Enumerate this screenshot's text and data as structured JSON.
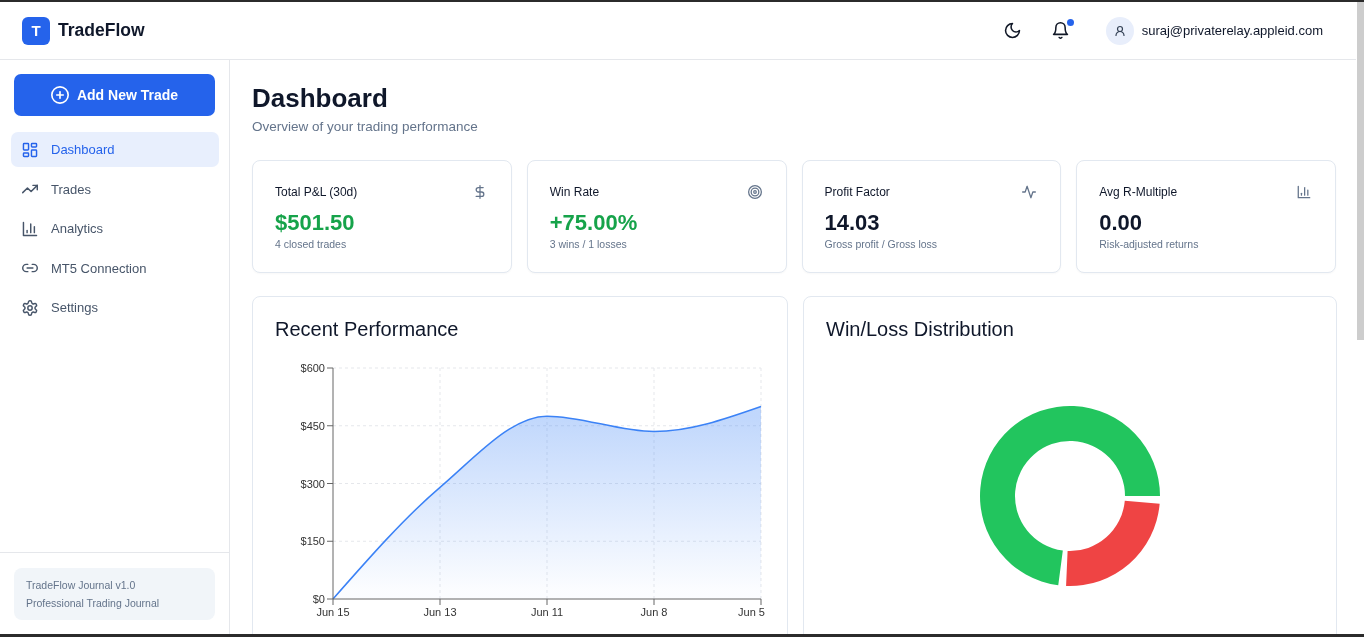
{
  "header": {
    "logo": {
      "mark": "T",
      "name": "TradeFlow"
    },
    "notifications": {
      "unread": true
    },
    "user": {
      "email": "suraj@privaterelay.appleid.com"
    }
  },
  "sidebar": {
    "action": "Add New Trade",
    "items": [
      {
        "label": "Dashboard",
        "selected": true
      },
      {
        "label": "Trades",
        "selected": false
      },
      {
        "label": "Analytics",
        "selected": false
      },
      {
        "label": "MT5 Connection",
        "selected": false
      },
      {
        "label": "Settings",
        "selected": false
      }
    ],
    "footer": [
      "TradeFlow Journal v1.0",
      "Professional Trading Journal"
    ]
  },
  "page": {
    "title": "Dashboard",
    "subtitle": "Overview of your trading performance"
  },
  "stats": [
    {
      "label": "Total P&L (30d)",
      "value": "$501.50",
      "caption": "4 closed trades",
      "highlighted": true
    },
    {
      "label": "Win Rate",
      "value": "+75.00%",
      "caption": "3 wins / 1 losses",
      "highlighted": true
    },
    {
      "label": "Profit Factor",
      "value": "14.03",
      "caption": "Gross profit / Gross loss",
      "highlighted": false
    },
    {
      "label": "Avg R-Multiple",
      "value": "0.00",
      "caption": "Risk-adjusted returns",
      "highlighted": false
    }
  ],
  "charts": [
    {
      "kind": "line_chart",
      "title": "Recent Performance",
      "chart_data": {
        "type": "area",
        "categories": [
          "Jun 15",
          "Jun 13",
          "Jun 11",
          "Jun 8",
          "Jun 5"
        ],
        "series": [
          {
            "color": "#3b82f6",
            "values": [
              0,
              290,
              475,
              435,
              500
            ]
          }
        ],
        "ylim": [
          0,
          600
        ],
        "yticks": [
          {
            "value": 0,
            "label": "$0"
          },
          {
            "value": 150,
            "label": "$150"
          },
          {
            "value": 300,
            "label": "$300"
          },
          {
            "value": 450,
            "label": "$450"
          },
          {
            "value": 600,
            "label": "$600"
          }
        ],
        "grid": true
      }
    },
    {
      "kind": "donut",
      "title": "Win/Loss Distribution"
    }
  ]
}
